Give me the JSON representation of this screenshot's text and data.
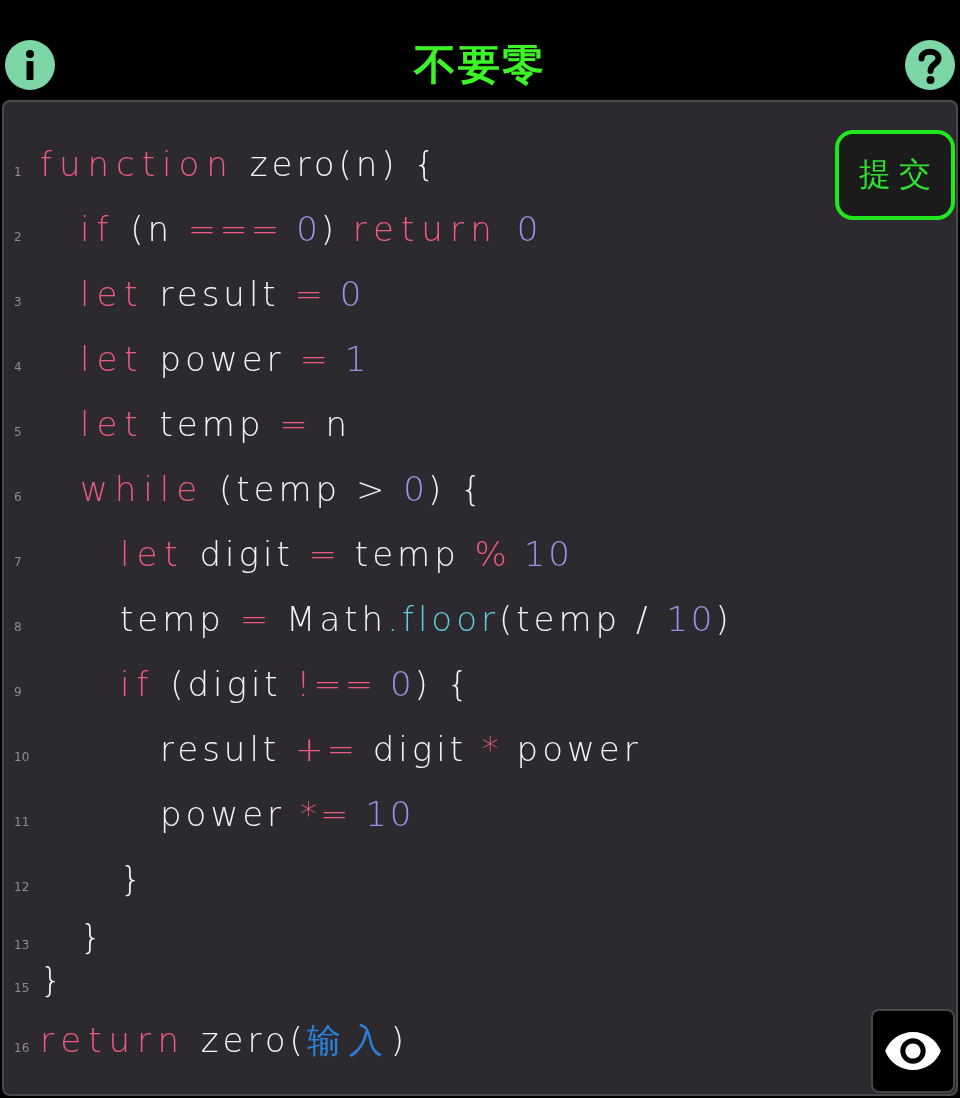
{
  "header": {
    "title": "不要零"
  },
  "submit_button": {
    "label": "提交"
  },
  "code": {
    "lines": [
      {
        "number": "1",
        "tokens": [
          {
            "text": "function",
            "kind": "keyword"
          },
          {
            "text": " zero(n) {",
            "kind": "plain"
          }
        ],
        "children": [
          {
            "number": "2",
            "tokens": [
              {
                "text": "if",
                "kind": "keyword"
              },
              {
                "text": " (n ",
                "kind": "plain"
              },
              {
                "text": "=== ",
                "kind": "operator"
              },
              {
                "text": "0",
                "kind": "number"
              },
              {
                "text": ") ",
                "kind": "plain"
              },
              {
                "text": "return ",
                "kind": "keyword"
              },
              {
                "text": "0",
                "kind": "number"
              }
            ]
          },
          {
            "number": "3",
            "tokens": [
              {
                "text": "let",
                "kind": "keyword"
              },
              {
                "text": " result ",
                "kind": "plain"
              },
              {
                "text": "= ",
                "kind": "operator"
              },
              {
                "text": "0",
                "kind": "number"
              }
            ]
          },
          {
            "number": "4",
            "tokens": [
              {
                "text": "let",
                "kind": "keyword"
              },
              {
                "text": " power ",
                "kind": "plain"
              },
              {
                "text": "= ",
                "kind": "operator"
              },
              {
                "text": "1",
                "kind": "number"
              }
            ]
          },
          {
            "number": "5",
            "tokens": [
              {
                "text": "let",
                "kind": "keyword"
              },
              {
                "text": " temp ",
                "kind": "plain"
              },
              {
                "text": "=",
                "kind": "operator"
              },
              {
                "text": " n",
                "kind": "plain"
              }
            ]
          },
          {
            "number": "6",
            "tokens": [
              {
                "text": "while",
                "kind": "keyword"
              },
              {
                "text": " (temp > ",
                "kind": "plain"
              },
              {
                "text": "0",
                "kind": "number"
              },
              {
                "text": ") {",
                "kind": "plain"
              }
            ],
            "children": [
              {
                "number": "7",
                "tokens": [
                  {
                    "text": "let",
                    "kind": "keyword"
                  },
                  {
                    "text": " digit ",
                    "kind": "plain"
                  },
                  {
                    "text": "=",
                    "kind": "operator"
                  },
                  {
                    "text": " temp ",
                    "kind": "plain"
                  },
                  {
                    "text": "% ",
                    "kind": "operator"
                  },
                  {
                    "text": "10",
                    "kind": "number"
                  }
                ]
              },
              {
                "number": "8",
                "tokens": [
                  {
                    "text": "temp ",
                    "kind": "plain"
                  },
                  {
                    "text": "=",
                    "kind": "operator"
                  },
                  {
                    "text": " Math",
                    "kind": "plain"
                  },
                  {
                    "text": ".floor",
                    "kind": "method"
                  },
                  {
                    "text": "(temp / ",
                    "kind": "plain"
                  },
                  {
                    "text": "10",
                    "kind": "number"
                  },
                  {
                    "text": ")",
                    "kind": "plain"
                  }
                ]
              },
              {
                "number": "9",
                "tokens": [
                  {
                    "text": "if",
                    "kind": "keyword"
                  },
                  {
                    "text": " (digit ",
                    "kind": "plain"
                  },
                  {
                    "text": "!== ",
                    "kind": "operator"
                  },
                  {
                    "text": "0",
                    "kind": "number"
                  },
                  {
                    "text": ") {",
                    "kind": "plain"
                  }
                ],
                "children": [
                  {
                    "number": "10",
                    "tokens": [
                      {
                        "text": "result ",
                        "kind": "plain"
                      },
                      {
                        "text": "+=",
                        "kind": "operator"
                      },
                      {
                        "text": " digit ",
                        "kind": "plain"
                      },
                      {
                        "text": "*",
                        "kind": "operator"
                      },
                      {
                        "text": " power",
                        "kind": "plain"
                      }
                    ]
                  },
                  {
                    "number": "11",
                    "tokens": [
                      {
                        "text": "power ",
                        "kind": "plain"
                      },
                      {
                        "text": "*= ",
                        "kind": "operator"
                      },
                      {
                        "text": "10",
                        "kind": "number"
                      }
                    ]
                  }
                ]
              },
              {
                "number": "12",
                "tokens": [
                  {
                    "text": "}",
                    "kind": "plain"
                  }
                ]
              }
            ]
          },
          {
            "number": "13",
            "tokens": [
              {
                "text": "}",
                "kind": "plain"
              }
            ]
          }
        ]
      },
      {
        "number": "15",
        "tokens": [
          {
            "text": "}",
            "kind": "plain"
          }
        ]
      },
      {
        "number": "16",
        "tokens": [
          {
            "text": "return",
            "kind": "keyword"
          },
          {
            "text": " zero(",
            "kind": "plain"
          },
          {
            "text": "输入",
            "kind": "input"
          },
          {
            "text": ")",
            "kind": "plain"
          }
        ]
      }
    ]
  }
}
